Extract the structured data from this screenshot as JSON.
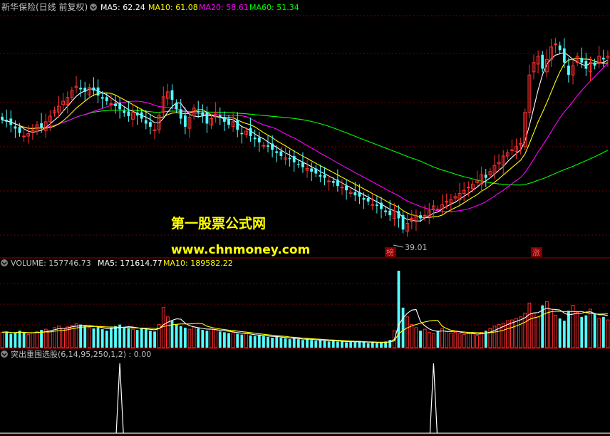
{
  "colors": {
    "background": "#000000",
    "grid": "#7a0000",
    "up": "#ff3030",
    "down": "#54ffff",
    "ma5": "#ffffff",
    "ma10": "#ffff00",
    "ma20": "#ff00ff",
    "ma60": "#00ff00",
    "label": "#c0c0c0",
    "watermark": "#ffff00"
  },
  "price_panel": {
    "title": "新华保险(日线 前复权)",
    "legend": [
      {
        "text": "MA5: 62.24",
        "color": "#ffffff"
      },
      {
        "text": "MA10: 61.08",
        "color": "#ffff00"
      },
      {
        "text": "MA20: 58.61",
        "color": "#ff00ff"
      },
      {
        "text": "MA60: 51.34",
        "color": "#00ff00"
      }
    ],
    "low_marker": "39.01",
    "tags": [
      {
        "text": "榜",
        "color": "#ff3030",
        "bg": "#7a0000"
      },
      {
        "text": "涨",
        "color": "#ff3030",
        "bg": "#7a0000"
      }
    ]
  },
  "volume_panel": {
    "legend": [
      {
        "text": "VOLUME: 157746.73",
        "color": "#c0c0c0"
      },
      {
        "text": "MA5: 171614.77",
        "color": "#ffffff"
      },
      {
        "text": "MA10: 189582.22",
        "color": "#ffff00"
      }
    ]
  },
  "indicator_panel": {
    "legend": [
      {
        "text": "突出重围选股(6,14,95,250,1,2) : 0.00",
        "color": "#c0c0c0"
      }
    ]
  },
  "watermark": {
    "line1": "第一股票公式网",
    "line2": "www.chnmoney.com"
  },
  "chart_data": {
    "type": "candlestick",
    "closes": [
      58.2,
      57.9,
      57.4,
      56.8,
      56.1,
      55.6,
      56.0,
      56.6,
      57.4,
      57.0,
      57.9,
      58.8,
      59.7,
      60.4,
      61.2,
      61.8,
      62.9,
      63.6,
      63.1,
      62.7,
      63.4,
      62.9,
      62.1,
      61.6,
      61.2,
      60.8,
      60.4,
      59.9,
      59.3,
      58.8,
      59.4,
      58.9,
      58.4,
      57.6,
      57.1,
      56.6,
      58.9,
      61.9,
      62.7,
      61.4,
      59.9,
      58.4,
      57.1,
      58.6,
      60.1,
      59.4,
      58.9,
      57.6,
      58.4,
      59.4,
      58.6,
      57.9,
      57.4,
      57.9,
      56.6,
      55.9,
      56.4,
      55.6,
      55.1,
      54.6,
      54.1,
      53.9,
      53.4,
      52.9,
      52.4,
      52.1,
      51.9,
      51.4,
      51.1,
      50.6,
      50.4,
      49.9,
      49.6,
      49.1,
      48.9,
      48.4,
      48.1,
      47.6,
      47.4,
      46.9,
      46.6,
      46.1,
      45.9,
      45.4,
      45.1,
      44.6,
      44.4,
      43.9,
      43.4,
      42.9,
      43.6,
      42.4,
      40.6,
      41.6,
      42.4,
      42.9,
      42.4,
      42.9,
      43.6,
      44.4,
      43.9,
      44.6,
      45.1,
      45.4,
      45.9,
      46.4,
      46.9,
      47.4,
      47.9,
      48.4,
      49.4,
      48.9,
      49.9,
      50.9,
      51.4,
      52.4,
      52.9,
      53.4,
      53.9,
      54.4,
      59.4,
      65.4,
      67.4,
      68.4,
      66.4,
      67.9,
      69.9,
      70.4,
      69.4,
      67.4,
      65.4,
      66.9,
      68.4,
      67.4,
      66.4,
      67.4,
      66.9,
      68.4,
      67.9,
      68.4
    ],
    "ohlc_note": "values estimated from the chart",
    "volumes": [
      0.2,
      0.21,
      0.18,
      0.19,
      0.22,
      0.2,
      0.17,
      0.19,
      0.21,
      0.23,
      0.24,
      0.22,
      0.26,
      0.28,
      0.25,
      0.27,
      0.29,
      0.31,
      0.3,
      0.28,
      0.26,
      0.25,
      0.27,
      0.24,
      0.22,
      0.26,
      0.28,
      0.3,
      0.27,
      0.25,
      0.24,
      0.23,
      0.26,
      0.24,
      0.22,
      0.21,
      0.3,
      0.52,
      0.4,
      0.35,
      0.3,
      0.28,
      0.26,
      0.24,
      0.27,
      0.25,
      0.23,
      0.22,
      0.24,
      0.23,
      0.21,
      0.2,
      0.19,
      0.2,
      0.18,
      0.17,
      0.18,
      0.16,
      0.15,
      0.16,
      0.15,
      0.14,
      0.13,
      0.14,
      0.13,
      0.12,
      0.11,
      0.12,
      0.11,
      0.1,
      0.11,
      0.1,
      0.09,
      0.1,
      0.09,
      0.08,
      0.09,
      0.08,
      0.08,
      0.07,
      0.08,
      0.07,
      0.08,
      0.07,
      0.06,
      0.07,
      0.06,
      0.07,
      0.08,
      0.1,
      0.22,
      1.0,
      0.52,
      0.4,
      0.3,
      0.26,
      0.22,
      0.24,
      0.2,
      0.18,
      0.22,
      0.25,
      0.21,
      0.19,
      0.2,
      0.18,
      0.17,
      0.19,
      0.18,
      0.16,
      0.2,
      0.22,
      0.25,
      0.28,
      0.3,
      0.32,
      0.35,
      0.36,
      0.38,
      0.4,
      0.45,
      0.58,
      0.45,
      0.4,
      0.55,
      0.6,
      0.5,
      0.42,
      0.38,
      0.35,
      0.48,
      0.55,
      0.46,
      0.4,
      0.42,
      0.5,
      0.44,
      0.38,
      0.4,
      0.36
    ],
    "signal_bars": [
      27,
      99
    ]
  }
}
